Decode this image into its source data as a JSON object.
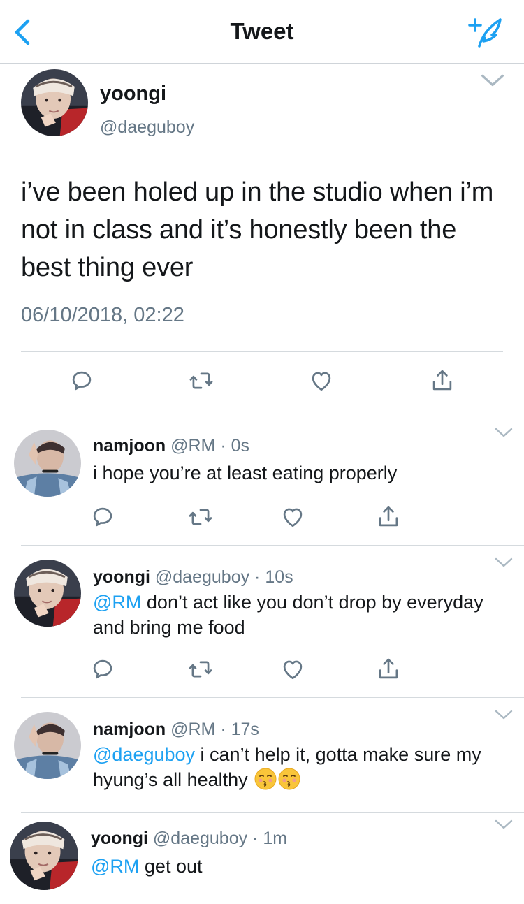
{
  "nav": {
    "title": "Tweet",
    "back_icon": "chevron-left-icon",
    "compose_icon": "compose-tweet-icon",
    "accent": "#1da1f2"
  },
  "main_tweet": {
    "name": "yoongi",
    "handle": "@daeguboy",
    "text": "i’ve been holed up in the studio when i’m not in class and it’s honestly been the best thing ever",
    "timestamp": "06/10/2018, 02:22",
    "actions": [
      "reply-icon",
      "retweet-icon",
      "like-icon",
      "share-icon"
    ]
  },
  "replies": [
    {
      "name": "namjoon",
      "meta": "@RM · 0s",
      "mention": "",
      "text": "i hope you’re at least eating properly"
    },
    {
      "name": "yoongi",
      "meta": "@daeguboy · 10s",
      "mention": "@RM",
      "text": " don’t act like you don’t drop by everyday and bring me food"
    },
    {
      "name": "namjoon",
      "meta": "@RM · 17s",
      "mention": "@daeguboy",
      "text": " i can’t help it, gotta make sure my hyung’s all healthy",
      "emoji": [
        "kissing-face-icon",
        "kissing-face-icon"
      ]
    },
    {
      "name": "yoongi",
      "meta": "@daeguboy · 1m",
      "mention": "@RM",
      "text": " get out"
    }
  ]
}
